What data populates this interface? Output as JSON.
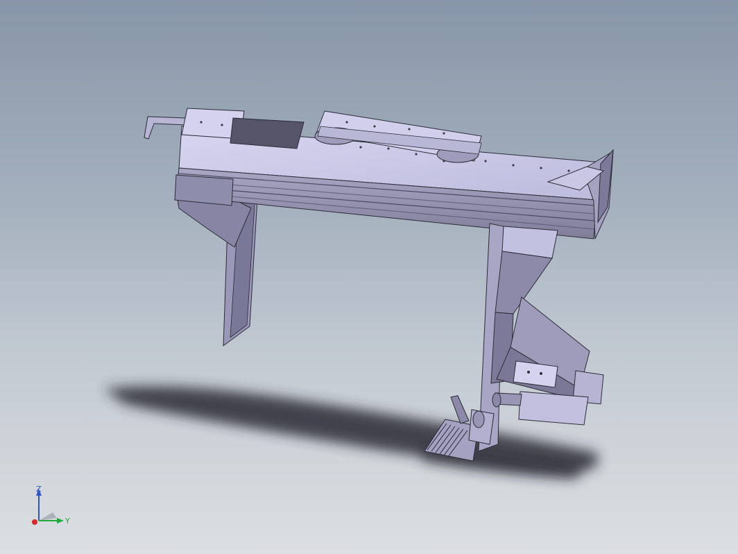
{
  "viewport": {
    "background_top": "#8796a8",
    "background_bottom": "#dcdfe2",
    "model_face_color": "#c7c5e6",
    "model_side_color": "#8e8ca8",
    "model_edge_color": "#2a2a38"
  },
  "triad": {
    "z_label": "Z",
    "y_label": "Y",
    "z_color": "#2e56c8",
    "y_color": "#23a83a",
    "x_color": "#d42a2a"
  }
}
